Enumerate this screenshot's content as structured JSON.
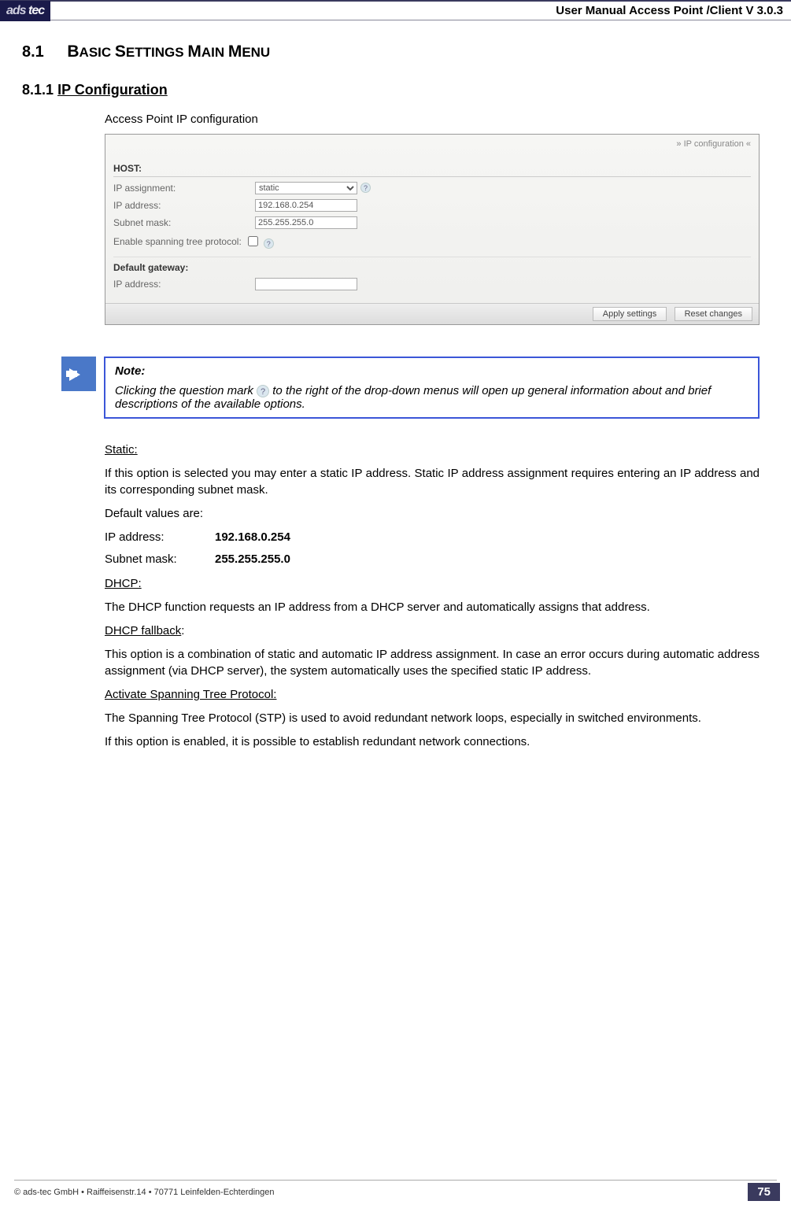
{
  "header": {
    "logo": "ads tec",
    "title": "User Manual Access  Point /Client V 3.0.3"
  },
  "section": {
    "number": "8.1",
    "title_caps": "Basic Settings Main Menu"
  },
  "subsection": {
    "number": "8.1.1",
    "title": "IP Configuration"
  },
  "intro": "Access Point IP configuration",
  "screenshot": {
    "breadcrumb": "» IP configuration «",
    "host_label": "HOST:",
    "rows": {
      "ip_assignment": {
        "label": "IP assignment:",
        "value": "static"
      },
      "ip_address": {
        "label": "IP address:",
        "value": "192.168.0.254"
      },
      "subnet_mask": {
        "label": "Subnet mask:",
        "value": "255.255.255.0"
      },
      "stp": {
        "label": "Enable spanning tree protocol:"
      }
    },
    "gateway_label": "Default gateway:",
    "gateway_ip_label": "IP address:",
    "gateway_ip_value": "",
    "buttons": {
      "apply": "Apply settings",
      "reset": "Reset changes"
    }
  },
  "note": {
    "title": "Note:",
    "body_prefix": "Clicking the question mark ",
    "body_suffix": " to the right of the drop-down menus will open up general information about and brief descriptions of the available options."
  },
  "body": {
    "static_h": "Static:",
    "static_p": "If this option is selected you may enter a static IP address. Static IP address assignment requires entering an IP address and its corresponding subnet mask.",
    "defaults_h": "Default values are:",
    "ip_lbl": "IP address:",
    "ip_val": "192.168.0.254",
    "sm_lbl": "Subnet mask:",
    "sm_val": "255.255.255.0",
    "dhcp_h": "DHCP:",
    "dhcp_p": "The DHCP function requests an IP address from a DHCP server and automatically assigns that address.",
    "fallback_h": "DHCP fallback",
    "fallback_colon": ":",
    "fallback_p": "This option is a combination of static and automatic IP address assignment. In case an error occurs during automatic address assignment (via DHCP server), the system automatically uses the specified static IP address.",
    "stp_h": "Activate Spanning Tree Protocol:",
    "stp_p": "The Spanning Tree Protocol (STP) is used to avoid redundant network loops, especially in switched environments.",
    "stp_p2": "If this option is enabled, it is possible to establish redundant network connections."
  },
  "footer": {
    "left": "© ads-tec GmbH • Raiffeisenstr.14 • 70771 Leinfelden-Echterdingen",
    "page": "75"
  }
}
